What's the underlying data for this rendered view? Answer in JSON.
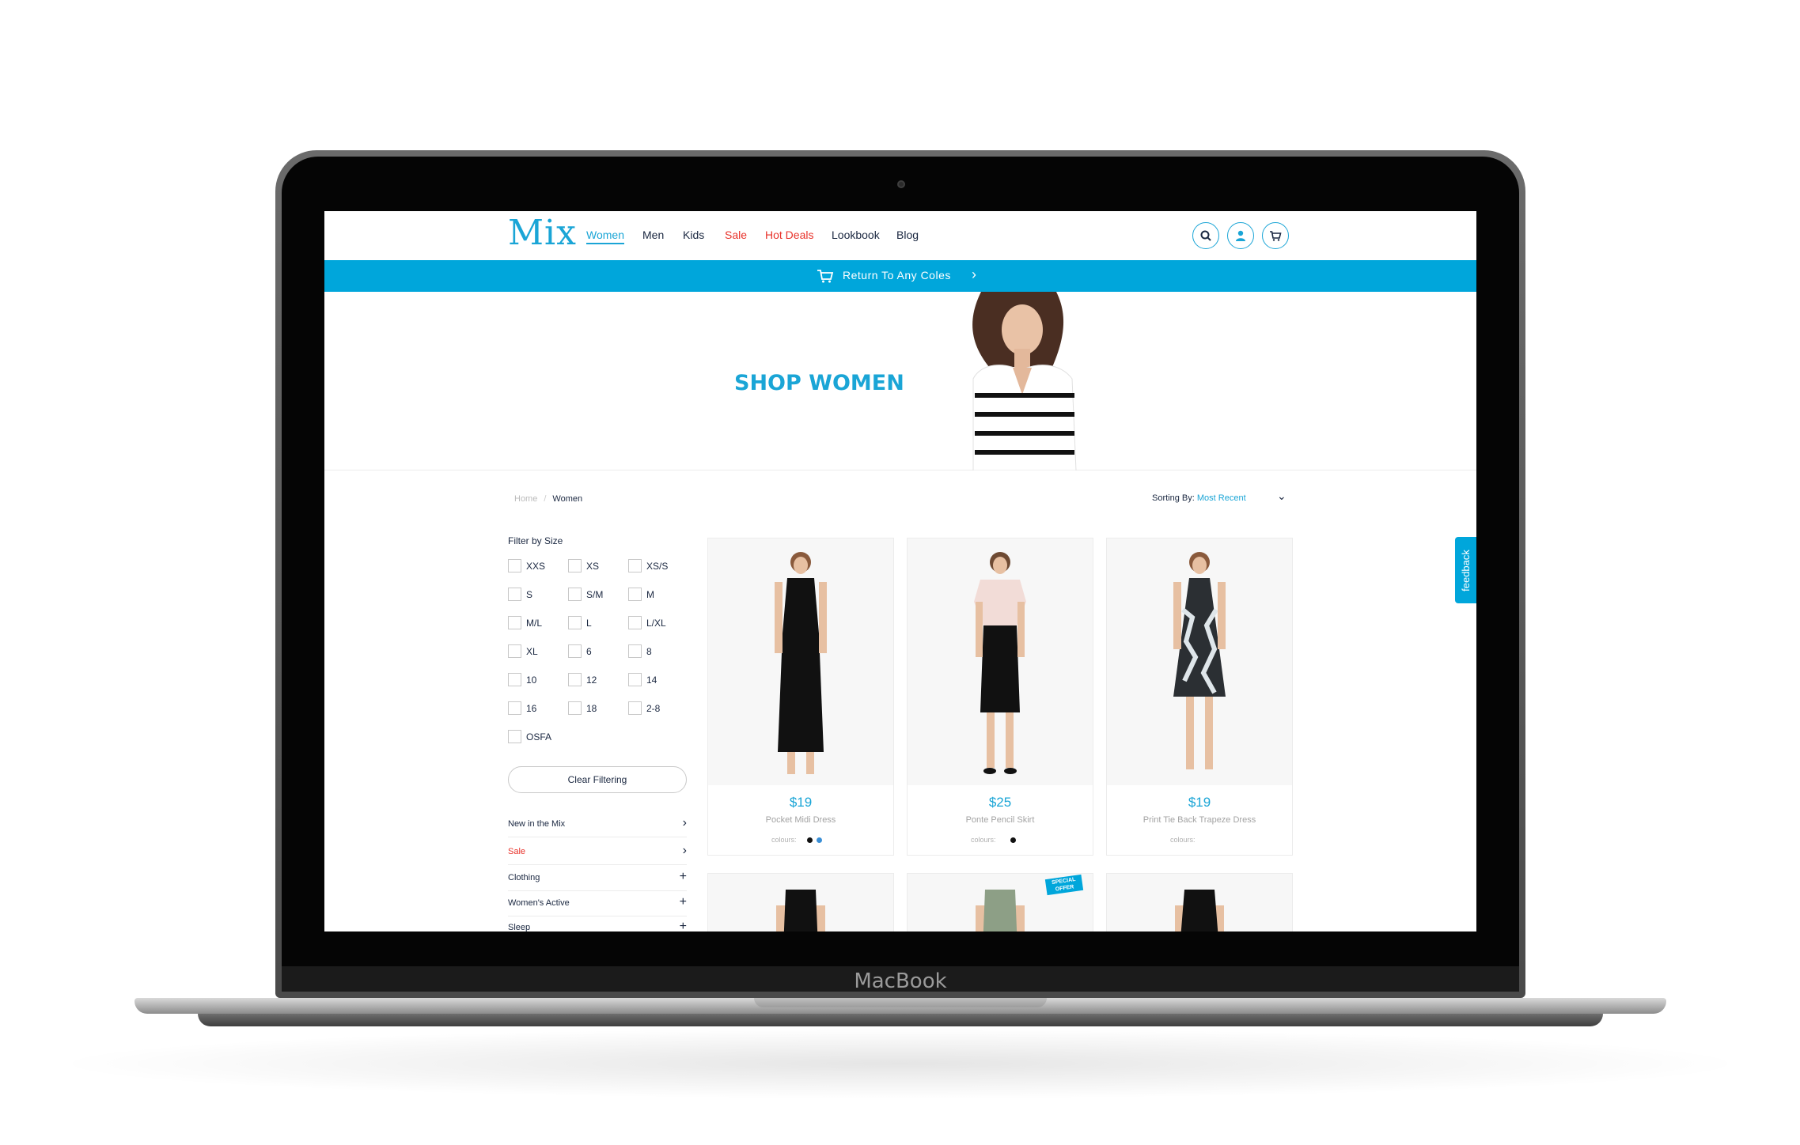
{
  "device": {
    "brand_label": "MacBook"
  },
  "header": {
    "logo": "Mix",
    "nav": [
      "Women",
      "Men",
      "Kids",
      "Sale",
      "Hot Deals",
      "Lookbook",
      "Blog"
    ],
    "icons": [
      "search-icon",
      "account-icon",
      "cart-icon"
    ]
  },
  "promo": {
    "text": "Return To Any Coles",
    "icon": "cart-icon"
  },
  "hero": {
    "title": "SHOP WOMEN"
  },
  "breadcrumb": {
    "home": "Home",
    "separator": "/",
    "current": "Women"
  },
  "sort": {
    "label": "Sorting By:",
    "value": "Most Recent"
  },
  "filter": {
    "title": "Filter by Size",
    "sizes": [
      "XXS",
      "XS",
      "XS/S",
      "S",
      "S/M",
      "M",
      "M/L",
      "L",
      "L/XL",
      "XL",
      "6",
      "8",
      "10",
      "12",
      "14",
      "16",
      "18",
      "2-8",
      "OSFA"
    ],
    "clear_label": "Clear Filtering"
  },
  "categories": [
    {
      "label": "New in the Mix",
      "icon": "chevron-right-icon"
    },
    {
      "label": "Sale",
      "icon": "chevron-right-icon"
    },
    {
      "label": "Clothing",
      "icon": "plus-icon"
    },
    {
      "label": "Women's Active",
      "icon": "plus-icon"
    },
    {
      "label": "Sleep",
      "icon": "plus-icon"
    }
  ],
  "products": [
    {
      "price": "$19",
      "name": "Pocket Midi Dress",
      "colours_label": "colours:",
      "colours": [
        "#111111",
        "#3a8fd6"
      ]
    },
    {
      "price": "$25",
      "name": "Ponte Pencil Skirt",
      "colours_label": "colours:",
      "colours": [
        "#111111"
      ]
    },
    {
      "price": "$19",
      "name": "Print Tie Back Trapeze Dress",
      "colours_label": "colours:",
      "colours": []
    }
  ],
  "badge": {
    "line1": "SPECIAL",
    "line2": "OFFER"
  },
  "feedback": {
    "label": "feedback"
  },
  "colors": {
    "accent": "#00a6db",
    "sale": "#e8322a",
    "text": "#1a2740"
  }
}
